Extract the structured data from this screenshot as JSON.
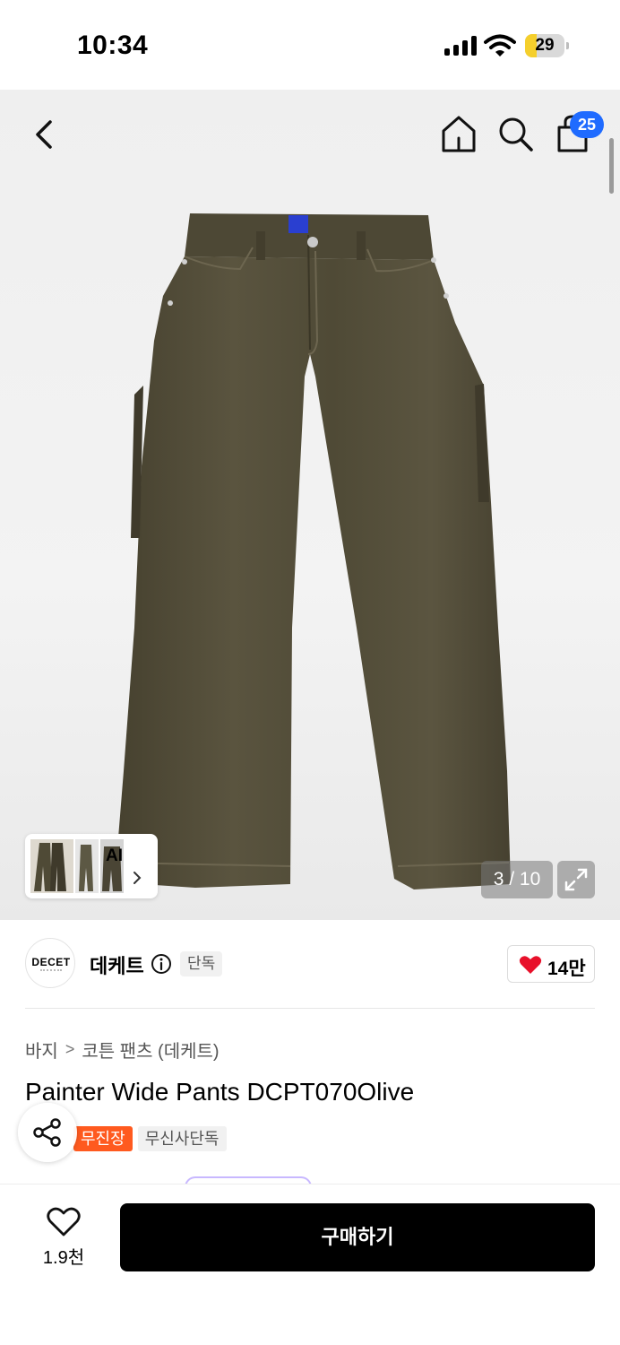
{
  "status_bar": {
    "time": "10:34",
    "battery_level": "29",
    "battery_percent": 29,
    "icons": [
      "signal-icon",
      "wifi-icon",
      "battery-icon"
    ]
  },
  "top_nav": {
    "icons": [
      "back-icon",
      "home-icon",
      "search-icon",
      "cart-icon"
    ],
    "cart_count": "25"
  },
  "gallery": {
    "counter": "3 / 10",
    "ai_label": "AI",
    "background_color": "#efefef",
    "product_color": "#4f4a3a"
  },
  "brand": {
    "logo_text": "DECET",
    "name": "데케트",
    "exclusive_tag": "단독",
    "like_count": "14만"
  },
  "product": {
    "breadcrumb": [
      "바지",
      "코튼 팬츠 (데케트)"
    ],
    "breadcrumb_separator": ">",
    "title": "Painter Wide Pants DCPT070Olive",
    "tags": [
      "무진장",
      "무신사단독"
    ]
  },
  "bottom_bar": {
    "wish_count": "1.9천",
    "buy_label": "구매하기",
    "accent_color": "#000000"
  },
  "colors": {
    "cart_badge": "#1f6bff",
    "tag_orange": "#ff5a1f",
    "heart": "#e8102a"
  }
}
